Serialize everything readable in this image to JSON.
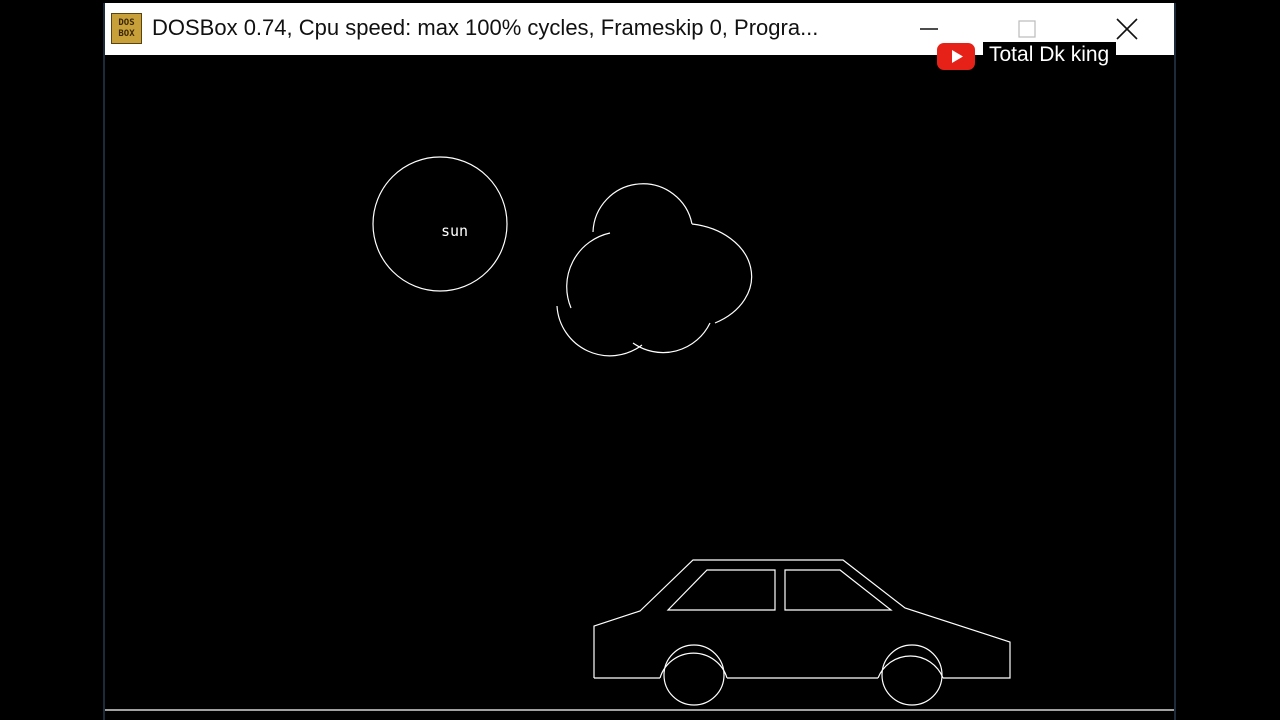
{
  "window": {
    "title": "DOSBox 0.74, Cpu speed: max 100% cycles, Frameskip  0, Progra...",
    "icon_text_top": "DOS",
    "icon_text_bottom": "BOX",
    "icons": {
      "app": "dosbox-icon",
      "minimize": "minimize-icon",
      "maximize": "maximize-icon",
      "close": "close-icon"
    }
  },
  "overlay": {
    "channel_name": "Total Dk king",
    "icon": "youtube-icon",
    "color": "#e62117"
  },
  "scene": {
    "sun_label": "sun",
    "background": "#000000",
    "stroke": "#ffffff"
  }
}
